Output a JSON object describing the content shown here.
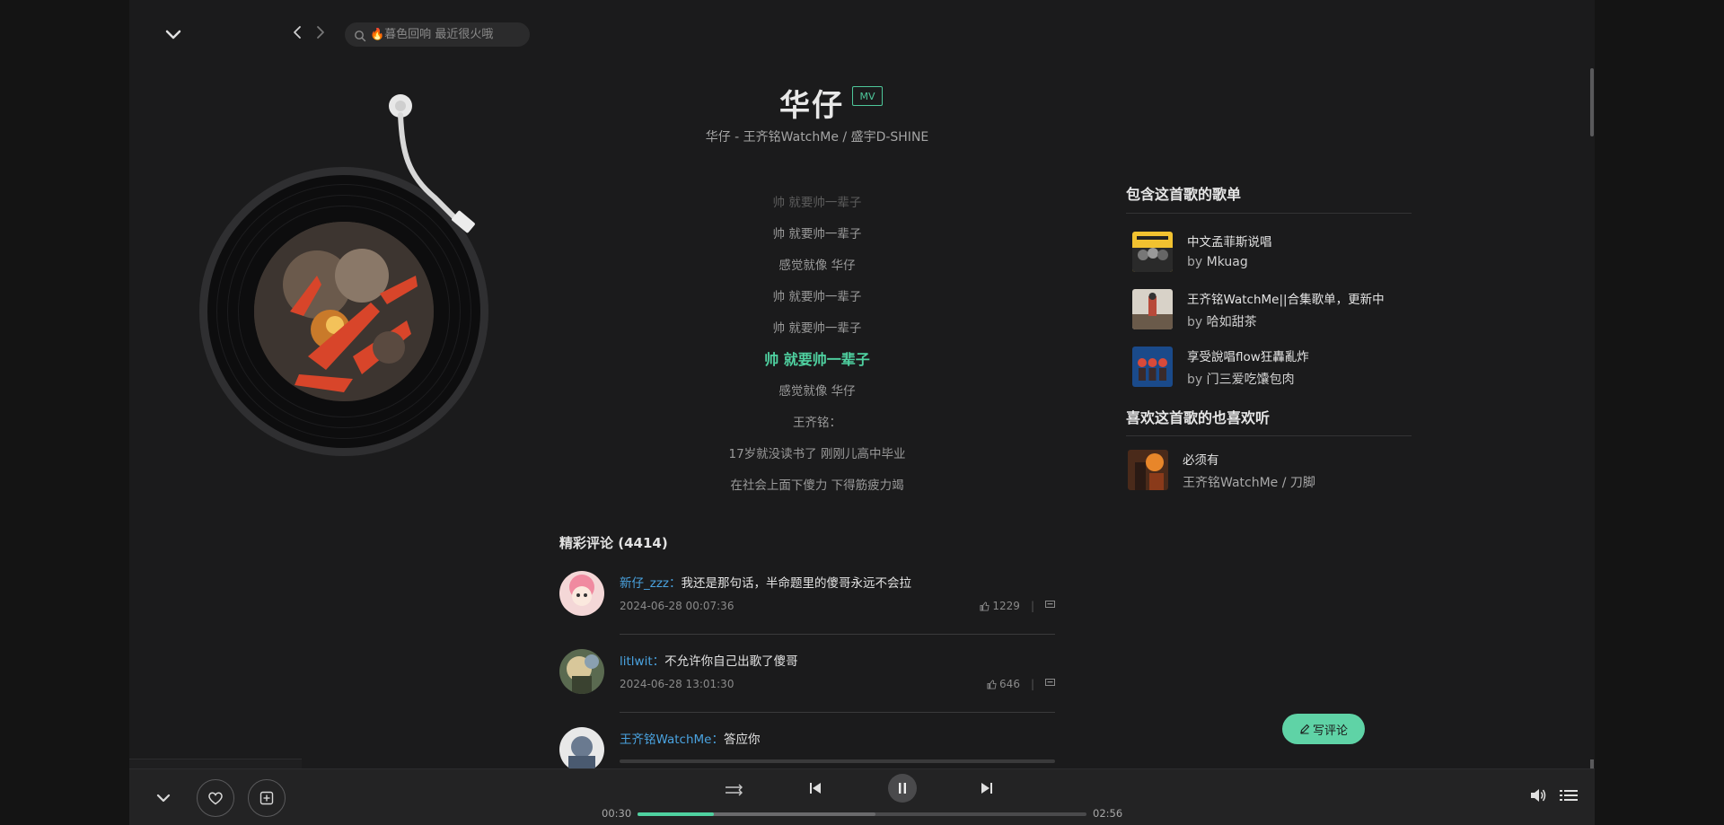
{
  "topbar": {
    "search_placeholder": "🔥暮色回响 最近很火哦"
  },
  "song": {
    "title": "华仔",
    "mv_label": "MV",
    "meta": "华仔 - 王齐铭WatchMe / 盛宇D-SHINE"
  },
  "lyrics": [
    "帅 就要帅一辈子",
    "帅 就要帅一辈子",
    "感觉就像 华仔",
    "帅 就要帅一辈子",
    "帅 就要帅一辈子",
    "帅 就要帅一辈子",
    "感觉就像 华仔",
    "王齐铭：",
    "17岁就没读书了 刚刚儿高中毕业",
    "在社会上面下傻力 下得筋疲力竭"
  ],
  "current_lyric_index": 5,
  "comments": {
    "title": "精彩评论 (4414)",
    "items": [
      {
        "user": "新仔_zzz：",
        "text": "我还是那句话，半命题里的傻哥永远不会拉",
        "time": "2024-06-28 00:07:36",
        "likes": "1229"
      },
      {
        "user": "litlwit：",
        "text": "不允许你自己出歌了傻哥",
        "time": "2024-06-28 13:01:30",
        "likes": "646"
      },
      {
        "user": "王齐铭WatchMe：",
        "text": "答应你",
        "time": "",
        "likes": ""
      }
    ]
  },
  "playlists": {
    "title": "包含这首歌的歌单",
    "items": [
      {
        "name": "中文孟菲斯说唱",
        "by_prefix": "by",
        "author": "Mkuag"
      },
      {
        "name": "王齐铭WatchMe||合集歌单，更新中",
        "by_prefix": "by",
        "author": "哈如甜茶"
      },
      {
        "name": "享受說唱flow狂轟亂炸",
        "by_prefix": "by",
        "author": "门三爱吃馕包肉"
      }
    ]
  },
  "similar": {
    "title": "喜欢这首歌的也喜欢听",
    "items": [
      {
        "name": "必须有",
        "artist": "王齐铭WatchMe / 刀脚"
      }
    ]
  },
  "write_comment_label": "写评论",
  "player": {
    "current_time": "00:30",
    "total_time": "02:56",
    "progress": 0.17,
    "buffered": 0.53
  },
  "colors": {
    "accent": "#4fd1a0",
    "username": "#4aa3e0",
    "background": "#1b1b1c"
  }
}
